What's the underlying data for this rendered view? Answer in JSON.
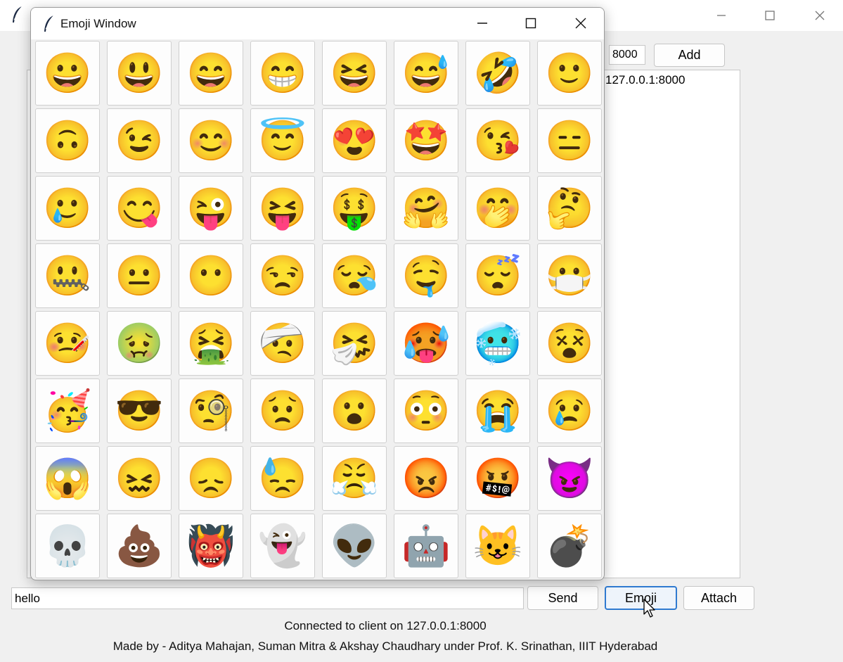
{
  "main": {
    "port_value": "8000",
    "add_label": "Add",
    "list_items": [
      "127.0.0.1:8000"
    ],
    "message_value": "hello",
    "send_label": "Send",
    "emoji_label": "Emoji",
    "attach_label": "Attach",
    "status_text": "Connected to client on 127.0.0.1:8000",
    "credits_text": "Made by - Aditya Mahajan, Suman Mitra & Akshay Chaudhary under Prof. K. Srinathan, IIIT Hyderabad"
  },
  "emoji_window": {
    "title": "Emoji Window",
    "emojis": [
      "😀",
      "😃",
      "😄",
      "😁",
      "😆",
      "😅",
      "🤣",
      "🙂",
      "🙃",
      "😉",
      "😊",
      "😇",
      "😍",
      "🤩",
      "😘",
      "😑",
      "🥲",
      "😋",
      "😜",
      "😝",
      "🤑",
      "🤗",
      "🤭",
      "🤔",
      "🤐",
      "😐",
      "😶",
      "😒",
      "😪",
      "🤤",
      "😴",
      "😷",
      "🤒",
      "🤢",
      "🤮",
      "🤕",
      "🤧",
      "🥵",
      "🥶",
      "😵",
      "🥳",
      "😎",
      "🧐",
      "😟",
      "😮",
      "😳",
      "😭",
      "😢",
      "😱",
      "😖",
      "😞",
      "😓",
      "😤",
      "😡",
      "🤬",
      "😈",
      "💀",
      "💩",
      "👹",
      "👻",
      "👽",
      "🤖",
      "😺",
      "💣"
    ]
  },
  "colors": {
    "accent": "#2f7ad0",
    "window_bg": "#f0f0f0",
    "titlebar_bg": "#ffffff"
  }
}
